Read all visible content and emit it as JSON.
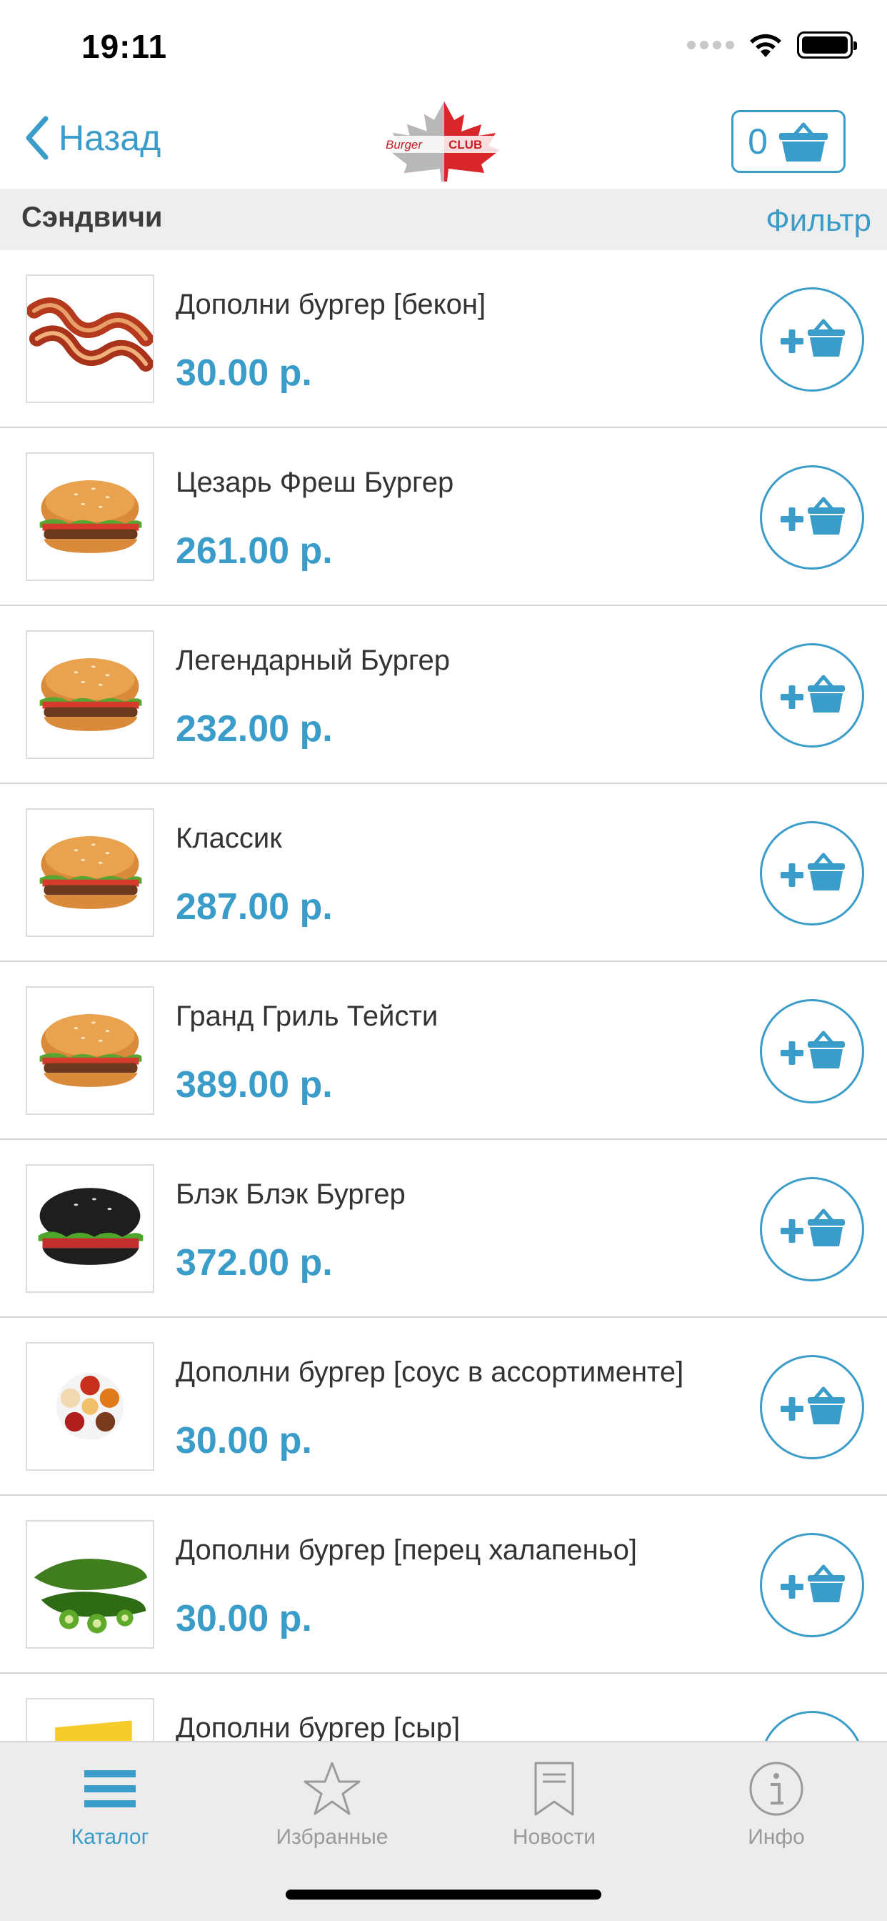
{
  "status_bar": {
    "time": "19:11"
  },
  "nav": {
    "back_label": "Назад",
    "logo_text_burger": "Burger",
    "logo_text_club": "CLUB",
    "cart_count": "0"
  },
  "section": {
    "title": "Сэндвичи",
    "filter_label": "Фильтр"
  },
  "products": [
    {
      "name": "Дополни бургер [бекон]",
      "price": "30.00 р.",
      "image": "bacon"
    },
    {
      "name": "Цезарь Фреш Бургер",
      "price": "261.00 р.",
      "image": "burger"
    },
    {
      "name": "Легендарный Бургер",
      "price": "232.00 р.",
      "image": "burger"
    },
    {
      "name": "Классик",
      "price": "287.00 р.",
      "image": "burger"
    },
    {
      "name": "Гранд Гриль Тейсти",
      "price": "389.00 р.",
      "image": "burger"
    },
    {
      "name": "Блэк Блэк Бургер",
      "price": "372.00 р.",
      "image": "black-burger"
    },
    {
      "name": "Дополни бургер [соус в ассортименте]",
      "price": "30.00 р.",
      "image": "sauces"
    },
    {
      "name": "Дополни бургер [перец халапеньо]",
      "price": "30.00 р.",
      "image": "jalapeno"
    },
    {
      "name": "Дополни бургер [сыр]",
      "price": "",
      "image": "cheese"
    }
  ],
  "tabs": [
    {
      "label": "Каталог",
      "icon": "menu-icon",
      "active": true
    },
    {
      "label": "Избранные",
      "icon": "star-icon",
      "active": false
    },
    {
      "label": "Новости",
      "icon": "bookmark-icon",
      "active": false
    },
    {
      "label": "Инфо",
      "icon": "info-icon",
      "active": false
    }
  ],
  "colors": {
    "accent": "#3a9cc8",
    "section_bg": "#eeeeee",
    "tab_bg": "#ececec"
  }
}
